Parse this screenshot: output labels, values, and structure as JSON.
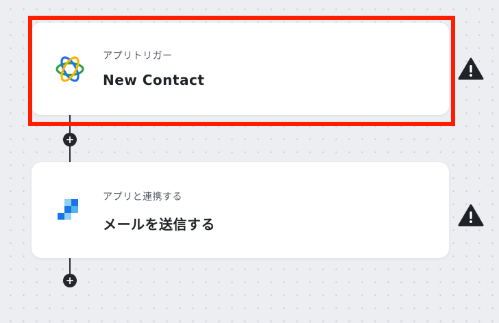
{
  "steps": [
    {
      "subtitle": "アプリトリガー",
      "title": "New Contact",
      "icon": "atom-rings-icon",
      "highlighted": true,
      "warning": true
    },
    {
      "subtitle": "アプリと連携する",
      "title": "メールを送信する",
      "icon": "blue-squares-icon",
      "highlighted": false,
      "warning": true
    }
  ],
  "add_step_symbol": "+",
  "colors": {
    "highlight": "#ff1d00",
    "canvas": "#eceef2",
    "node": "#24262b"
  }
}
